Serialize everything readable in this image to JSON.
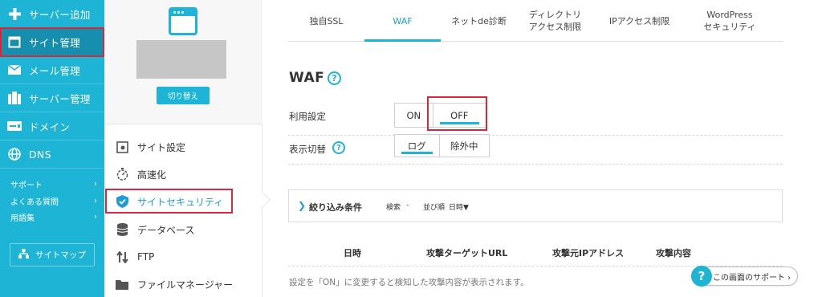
{
  "colors": {
    "accent": "#1eb4d5",
    "nav_active": "#168fae",
    "highlight_border": "#d8283a"
  },
  "left_nav": {
    "items": [
      {
        "label": "サーバー追加",
        "icon": "plus-icon"
      },
      {
        "label": "サイト管理",
        "icon": "window-icon",
        "active": true
      },
      {
        "label": "メール管理",
        "icon": "mail-icon"
      },
      {
        "label": "サーバー管理",
        "icon": "server-icon"
      },
      {
        "label": "ドメイン",
        "icon": "domain-icon"
      },
      {
        "label": "DNS",
        "icon": "globe-icon"
      }
    ],
    "links": [
      {
        "label": "サポート",
        "arrow": "›"
      },
      {
        "label": "よくある質問",
        "arrow": "›"
      },
      {
        "label": "用語集",
        "arrow": "›"
      }
    ],
    "sitemap_label": "サイトマップ"
  },
  "mid": {
    "switch_label": "切り替え",
    "items": [
      {
        "label": "サイト設定",
        "icon": "settings-icon"
      },
      {
        "label": "高速化",
        "icon": "stopwatch-icon"
      },
      {
        "label": "サイトセキュリティ",
        "icon": "shield-icon",
        "active": true
      },
      {
        "label": "データベース",
        "icon": "database-icon"
      },
      {
        "label": "FTP",
        "icon": "transfer-icon"
      },
      {
        "label": "ファイルマネージャー",
        "icon": "folder-icon"
      }
    ]
  },
  "tabs": [
    {
      "label": "独自SSL"
    },
    {
      "label": "WAF",
      "active": true
    },
    {
      "label": "ネットde診断"
    },
    {
      "line1": "ディレクトリ",
      "line2": "アクセス制限"
    },
    {
      "label": "IPアクセス制限"
    },
    {
      "line1": "WordPress",
      "line2": "セキュリティ"
    }
  ],
  "waf": {
    "title": "WAF",
    "help": "?",
    "usage": {
      "label": "利用設定",
      "on": "ON",
      "off": "OFF",
      "selected": "OFF"
    },
    "display": {
      "label": "表示切替",
      "log": "ログ",
      "excluded": "除外中",
      "selected": "ログ"
    },
    "filter": {
      "chevron": "❯",
      "title": "絞り込み条件",
      "search_label": "検索",
      "search_value": "-",
      "sort_label": "並び順",
      "sort_value": "日時▼"
    },
    "table_headers": [
      "日時",
      "攻撃ターゲットURL",
      "攻撃元IPアドレス",
      "攻撃内容"
    ],
    "empty_message": "設定を「ON」に変更すると検知した攻撃内容が表示されます。"
  },
  "support_button": {
    "icon_text": "?",
    "label": "この画面のサポート ›"
  }
}
